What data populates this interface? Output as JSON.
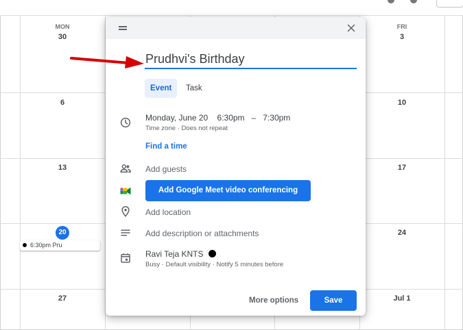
{
  "calendar": {
    "days_of_week": [
      "MON",
      "FRI"
    ],
    "rows": [
      {
        "mon": "30",
        "fri": "3"
      },
      {
        "mon": "6",
        "fri": "10"
      },
      {
        "mon": "13",
        "fri": "17"
      },
      {
        "mon": "20",
        "fri": "24"
      },
      {
        "mon": "27",
        "fri": "Jul 1"
      }
    ],
    "today": "20",
    "event_chip": {
      "time": "6:30pm",
      "title": "Pru"
    }
  },
  "dialog": {
    "title_value": "Prudhvi's Birthday",
    "tabs": [
      {
        "label": "Event",
        "active": true
      },
      {
        "label": "Task",
        "active": false
      }
    ],
    "datetime": {
      "date": "Monday, June 20",
      "start": "6:30pm",
      "separator": "–",
      "end": "7:30pm",
      "details": "Time zone · Does not repeat"
    },
    "find_time_label": "Find a time",
    "guests_placeholder": "Add guests",
    "meet_button_label": "Add Google Meet video conferencing",
    "location_placeholder": "Add location",
    "description_placeholder": "Add description or attachments",
    "calendar_owner": {
      "name": "Ravi Teja KNTS",
      "details": "Busy · Default visibility · Notify 5 minutes before",
      "color": "#000000"
    },
    "more_options_label": "More options",
    "save_label": "Save"
  },
  "icons": {
    "drag": "drag-handle-icon",
    "close": "close-icon",
    "clock": "clock-icon",
    "guests": "people-icon",
    "meet": "google-meet-icon",
    "location": "location-pin-icon",
    "description": "notes-icon",
    "calendar": "calendar-icon"
  },
  "colors": {
    "accent": "#1a73e8",
    "arrow": "#d50000",
    "tab_active_bg": "#e8f0fe"
  }
}
